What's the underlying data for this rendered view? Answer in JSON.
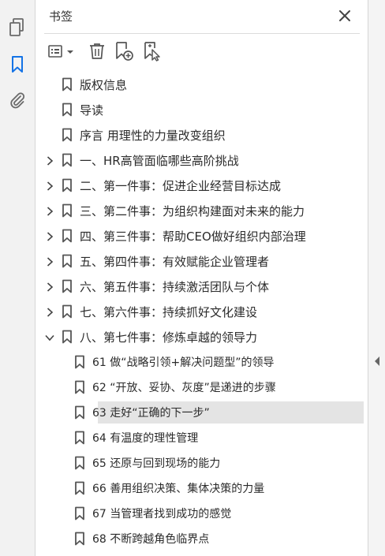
{
  "rail": {
    "icons": [
      "pages-icon",
      "bookmark-icon",
      "attachment-icon"
    ],
    "accent": "#1473e6"
  },
  "panel": {
    "title": "书签",
    "toolbar": [
      "options-icon",
      "delete-icon",
      "new-bookmark-icon",
      "find-bookmark-icon"
    ]
  },
  "bookmarks": [
    {
      "label": "版权信息",
      "level": 0,
      "expand": "none"
    },
    {
      "label": "导读",
      "level": 0,
      "expand": "none"
    },
    {
      "label": "序言 用理性的力量改变组织",
      "level": 0,
      "expand": "none"
    },
    {
      "label": "一、HR高管面临哪些高阶挑战",
      "level": 0,
      "expand": "collapsed"
    },
    {
      "label": "二、第一件事：促进企业经营目标达成",
      "level": 0,
      "expand": "collapsed"
    },
    {
      "label": "三、第二件事：为组织构建面对未来的能力",
      "level": 0,
      "expand": "collapsed"
    },
    {
      "label": "四、第三件事：帮助CEO做好组织内部治理",
      "level": 0,
      "expand": "collapsed"
    },
    {
      "label": "五、第四件事：有效赋能企业管理者",
      "level": 0,
      "expand": "collapsed"
    },
    {
      "label": "六、第五件事：持续激活团队与个体",
      "level": 0,
      "expand": "collapsed"
    },
    {
      "label": "七、第六件事：持续抓好文化建设",
      "level": 0,
      "expand": "collapsed"
    },
    {
      "label": "八、第七件事：修炼卓越的领导力",
      "level": 0,
      "expand": "expanded"
    },
    {
      "label": "61 做“战略引领+解决问题型”的领导",
      "level": 1,
      "expand": "none"
    },
    {
      "label": "62 “开放、妥协、灰度”是递进的步骤",
      "level": 1,
      "expand": "none"
    },
    {
      "label": "63 走好“正确的下一步”",
      "level": 1,
      "expand": "none",
      "selected": true
    },
    {
      "label": "64 有温度的理性管理",
      "level": 1,
      "expand": "none"
    },
    {
      "label": "65 还原与回到现场的能力",
      "level": 1,
      "expand": "none"
    },
    {
      "label": "66 善用组织决策、集体决策的力量",
      "level": 1,
      "expand": "none"
    },
    {
      "label": "67 当管理者找到成功的感觉",
      "level": 1,
      "expand": "none"
    },
    {
      "label": "68 不断跨越角色临界点",
      "level": 1,
      "expand": "none"
    }
  ]
}
